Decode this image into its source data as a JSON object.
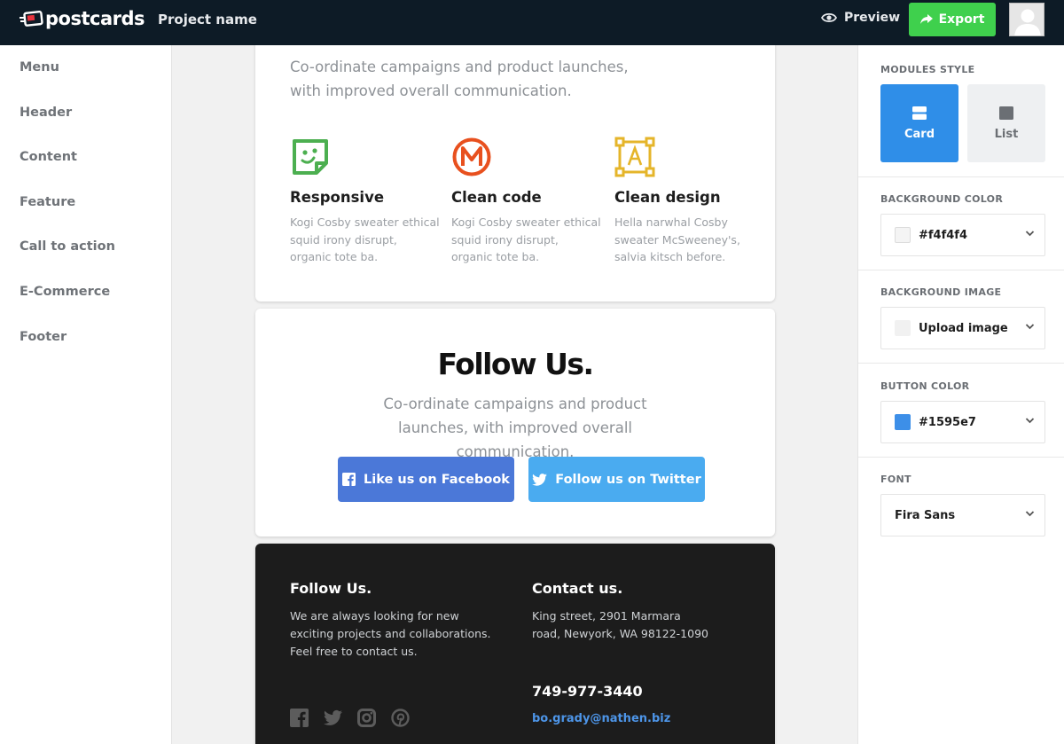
{
  "app": {
    "logo_text": "postcards",
    "project_name": "Project name",
    "preview_label": "Preview",
    "export_label": "Export"
  },
  "sidebar": {
    "items": [
      {
        "label": "Menu"
      },
      {
        "label": "Header"
      },
      {
        "label": "Content"
      },
      {
        "label": "Feature"
      },
      {
        "label": "Call to action"
      },
      {
        "label": "E-Commerce"
      },
      {
        "label": "Footer"
      }
    ]
  },
  "features_module": {
    "lead": "Co-ordinate campaigns and product launches, with improved overall communication.",
    "features": [
      {
        "title": "Responsive",
        "text": "Kogi Cosby sweater ethical squid irony disrupt, organic tote ba.",
        "icon": "sticker-icon",
        "color": "#4caf50"
      },
      {
        "title": "Clean code",
        "text": "Kogi Cosby sweater ethical squid irony disrupt, organic tote ba.",
        "icon": "m-badge-icon",
        "color": "#e8501e"
      },
      {
        "title": "Clean design",
        "text": "Hella narwhal Cosby sweater McSweeney's, salvia kitsch before.",
        "icon": "text-frame-icon",
        "color": "#e5b52a"
      }
    ]
  },
  "follow_module": {
    "title": "Follow Us.",
    "lead": "Co-ordinate campaigns and product launches, with improved overall communication.",
    "facebook_label": "Like us on Facebook",
    "twitter_label": "Follow us on Twitter"
  },
  "footer_module": {
    "follow_title": "Follow Us.",
    "follow_text": "We are always looking for new exciting projects and collaborations. Feel free to contact us.",
    "contact_title": "Contact us.",
    "address": "King street, 2901 Marmara road, Newyork, WA 98122-1090",
    "phone": "749-977-3440",
    "email": "bo.grady@nathen.biz",
    "social_icons": [
      "facebook-icon",
      "twitter-icon",
      "instagram-icon",
      "pinterest-icon"
    ]
  },
  "panel": {
    "modules_style_label": "MODULES STYLE",
    "style_card_label": "Card",
    "style_list_label": "List",
    "bg_color_label": "BACKGROUND COLOR",
    "bg_color_value": "#f4f4f4",
    "bg_image_label": "BACKGROUND IMAGE",
    "bg_image_value": "Upload image",
    "button_color_label": "BUTTON COLOR",
    "button_color_value": "#1595e7",
    "font_label": "FONT",
    "font_value": "Fira Sans"
  },
  "colors": {
    "topbar": "#0d1b26",
    "export": "#3fd04d",
    "accent": "#2f8ee8",
    "facebook": "#4b78d8",
    "twitter": "#4aabf0"
  }
}
